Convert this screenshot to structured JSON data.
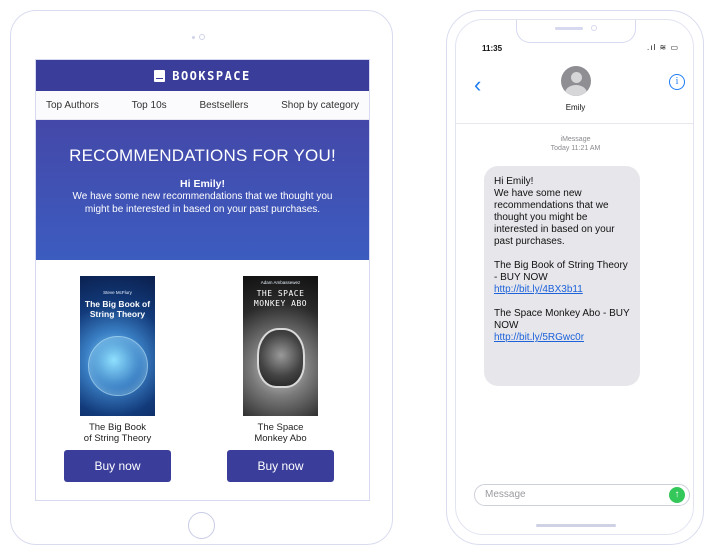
{
  "email": {
    "brand": "BOOKSPACE",
    "nav": [
      "Top Authors",
      "Top 10s",
      "Bestsellers",
      "Shop by category"
    ],
    "hero": {
      "title": "RECOMMENDATIONS FOR YOU!",
      "greeting": "Hi Emily!",
      "body": "We have some new recommendations that we thought you might be interested in based on your past purchases."
    },
    "books": [
      {
        "cover_author": "Steve McFlury",
        "cover_title": "The Big Book of String Theory",
        "name_line1": "The Big Book",
        "name_line2": "of String Theory",
        "button": "Buy now"
      },
      {
        "cover_author": "Adam Ambassewez",
        "cover_title": "THE SPACE MONKEY ABO",
        "name_line1": "The Space",
        "name_line2": "Monkey Abo",
        "button": "Buy now"
      }
    ]
  },
  "phone": {
    "time": "11:35",
    "contact_name": "Emily",
    "service": "iMessage",
    "timestamp": "Today 11:21 AM",
    "message": {
      "greeting": "Hi Emily!",
      "intro": "We have some new recommendations that we thought you might be interested in based on your past purchases.",
      "item1_text": "The Big Book of String Theory - BUY NOW",
      "item1_link": "http://bit.ly/4BX3b11",
      "item2_text": "The Space Monkey Abo - BUY NOW",
      "item2_link": "http://bit.ly/5RGwc0r"
    },
    "input_placeholder": "Message"
  },
  "colors": {
    "brand_primary": "#3a3d9a",
    "ios_blue": "#1d7cf2",
    "send_green": "#34c759"
  }
}
